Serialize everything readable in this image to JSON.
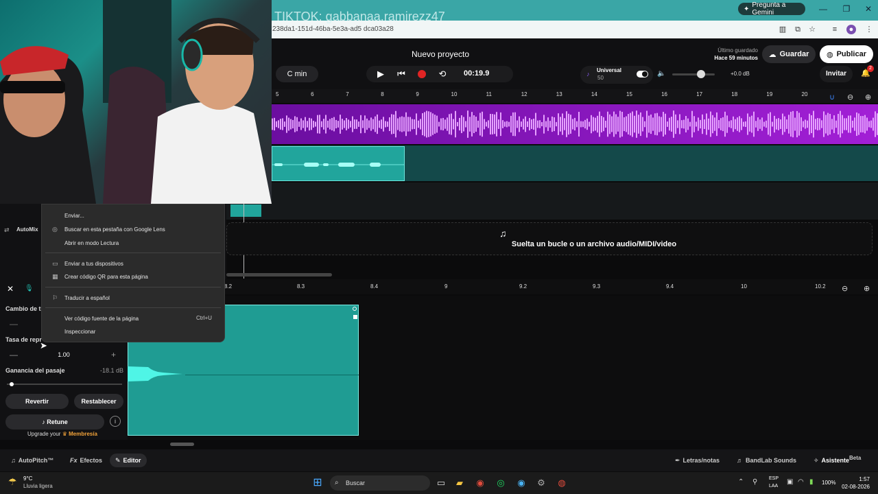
{
  "browser": {
    "overlay_title": "TIKTOK: gabbanaa.ramirezz47",
    "url": "238da1-151d-46ba-5e3a-ad5 dca03a28",
    "gemini_button": "Pregunta a Gemini"
  },
  "app": {
    "project_title": "Nuevo proyecto",
    "saved_label": "Último guardado",
    "saved_time": "Hace 59 minutos",
    "save_button": "Guardar",
    "publish_button": "Publicar",
    "key": "C min",
    "time": "00:19.9",
    "universal_label": "Universal",
    "universal_value": "50",
    "volume_db": "+0.0 dB",
    "invite_button": "Invitar",
    "notification_count": "2",
    "ruler_ticks": [
      "5",
      "6",
      "7",
      "8",
      "9",
      "10",
      "11",
      "12",
      "13",
      "14",
      "15",
      "16",
      "17",
      "18",
      "19",
      "20"
    ],
    "drop_zone_text": "Suelta un bucle o un archivo audio/MIDI/video",
    "automix_label": "AutoMix"
  },
  "editor": {
    "ruler_ticks": [
      "8.2",
      "8.3",
      "8.4",
      "9",
      "9.2",
      "9.3",
      "9.4",
      "10",
      "10.2"
    ],
    "pitch_label": "Cambio de t",
    "rate_label": "Tasa de repr",
    "rate_value": "1.00",
    "gain_label": "Ganancia del pasaje",
    "gain_value": "-18.1 dB",
    "gain_level": 0.04,
    "revert_button": "Revertir",
    "reset_button": "Restablecer",
    "retune_button": "Retune",
    "upgrade_prefix": "Upgrade your",
    "upgrade_accent": "Membresía"
  },
  "bottom_tabs": {
    "autopitch": "AutoPitch™",
    "effects": "Efectos",
    "editor": "Editor",
    "lyrics": "Letras/notas",
    "sounds": "BandLab Sounds",
    "assistant": "Asistente",
    "beta": "Beta"
  },
  "context_menu": {
    "items": [
      "Enviar...",
      "Buscar en esta pestaña con Google Lens",
      "Abrir en modo Lectura",
      "Enviar a tus dispositivos",
      "Crear código QR para esta página",
      "Traducir a español",
      "Ver código fuente de la página",
      "Inspeccionar"
    ],
    "shortcut": "Ctrl+U"
  },
  "taskbar": {
    "temperature": "9°C",
    "weather": "Lluvia ligera",
    "search_placeholder": "Buscar",
    "lang1": "ESP",
    "lang2": "LAA",
    "battery": "100%",
    "time": "1:57",
    "date": "02-08-2026"
  },
  "colors": {
    "accent_teal": "#21a59c",
    "track_purple": "#8a16c2",
    "record_red": "#e02424"
  }
}
